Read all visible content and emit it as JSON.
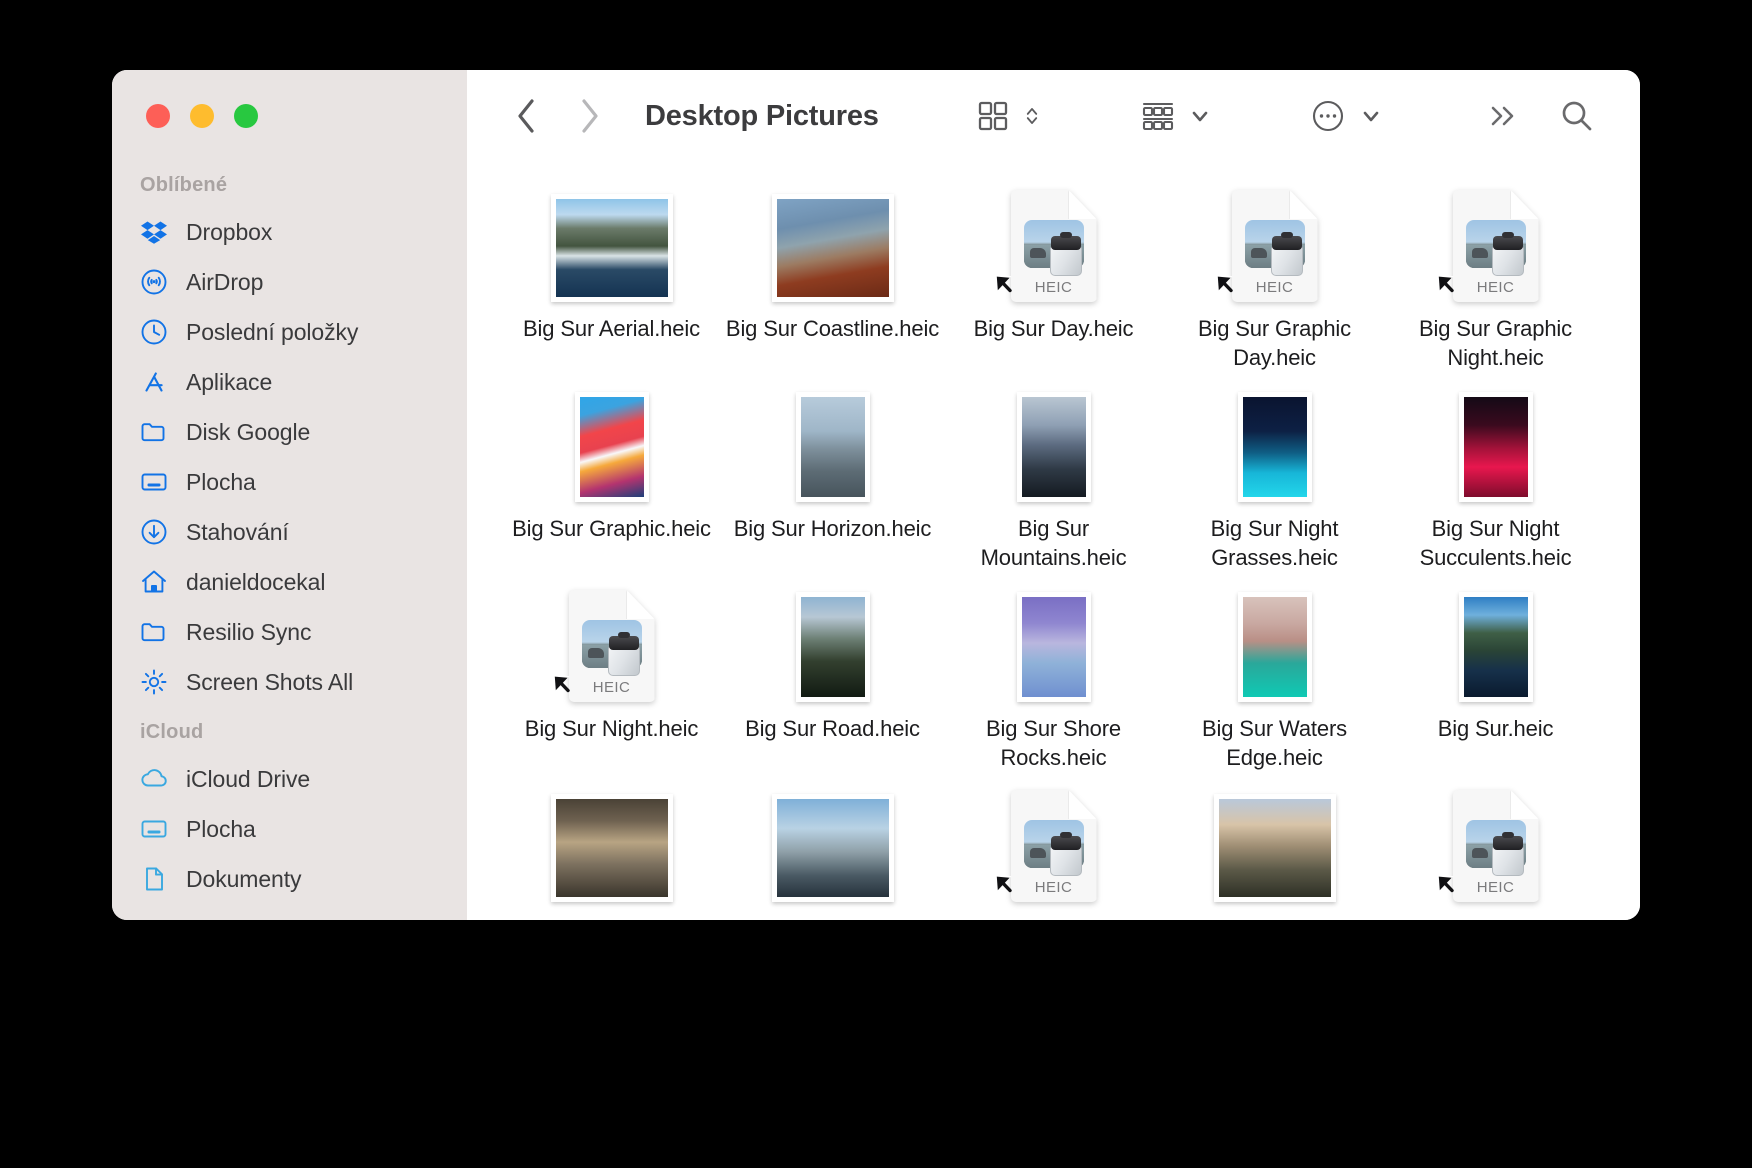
{
  "window": {
    "title": "Desktop Pictures",
    "traffic_lights": [
      {
        "name": "close",
        "color": "#fd5f57"
      },
      {
        "name": "minimize",
        "color": "#febc2e"
      },
      {
        "name": "maximize",
        "color": "#28c840"
      }
    ]
  },
  "toolbar": {
    "back_label": "Back",
    "forward_label": "Forward",
    "view_label": "Icon View",
    "group_label": "Group By",
    "action_label": "More Actions",
    "overflow_label": "More Toolbar Items",
    "search_label": "Search"
  },
  "sidebar": {
    "sections": [
      {
        "title": "Oblíbené",
        "items": [
          {
            "label": "Dropbox",
            "icon": "dropbox-icon",
            "color": "#1273e6"
          },
          {
            "label": "AirDrop",
            "icon": "airdrop-icon",
            "color": "#1273e6"
          },
          {
            "label": "Poslední položky",
            "icon": "clock-icon",
            "color": "#1273e6"
          },
          {
            "label": "Aplikace",
            "icon": "appstore-icon",
            "color": "#1273e6"
          },
          {
            "label": "Disk Google",
            "icon": "folder-icon",
            "color": "#1273e6"
          },
          {
            "label": "Plocha",
            "icon": "desktop-icon",
            "color": "#1273e6"
          },
          {
            "label": "Stahování",
            "icon": "download-icon",
            "color": "#1273e6"
          },
          {
            "label": "danieldocekal",
            "icon": "home-icon",
            "color": "#1273e6"
          },
          {
            "label": "Resilio Sync",
            "icon": "folder-icon",
            "color": "#1273e6"
          },
          {
            "label": "Screen Shots All",
            "icon": "gear-icon",
            "color": "#1273e6"
          }
        ]
      },
      {
        "title": "iCloud",
        "items": [
          {
            "label": "iCloud Drive",
            "icon": "cloud-icon",
            "color": "#3aa8e0"
          },
          {
            "label": "Plocha",
            "icon": "desktop-icon",
            "color": "#3aa8e0"
          },
          {
            "label": "Dokumenty",
            "icon": "document-icon",
            "color": "#3aa8e0"
          }
        ]
      }
    ]
  },
  "files": [
    {
      "name": "Big Sur Aerial.heic",
      "kind": "photo",
      "orientation": "landscape",
      "thumb": "linear-gradient(180deg,#8fc4e8 0%,#bdd9ef 16%,#6b7b6a 30%,#43543f 48%,#d9e3e6 58%,#2a4a66 72%,#143352 100%)",
      "alias": false
    },
    {
      "name": "Big Sur Coastline.heic",
      "kind": "photo",
      "orientation": "landscape",
      "thumb": "linear-gradient(170deg,#7fa3c4 0%,#6e8fae 26%,#8fa3ad 42%,#9c7b62 58%,#8e3c20 74%,#6b2a16 100%)",
      "alias": false
    },
    {
      "name": "Big Sur Day.heic",
      "kind": "heic-doc",
      "orientation": "doc",
      "thumb": "",
      "alias": true
    },
    {
      "name": "Big Sur Graphic Day.heic",
      "kind": "heic-doc",
      "orientation": "doc",
      "thumb": "",
      "alias": true
    },
    {
      "name": "Big Sur Graphic Night.heic",
      "kind": "heic-doc",
      "orientation": "doc",
      "thumb": "",
      "alias": true
    },
    {
      "name": "Big Sur Graphic.heic",
      "kind": "photo",
      "orientation": "portrait",
      "thumb": "linear-gradient(165deg,#2fa6e8 0%,#3ba3e0 16%,#f2454a 34%,#e8424f 48%,#f8f8fa 56%,#f6a93c 64%,#b4346f 82%,#1d3f7a 100%)",
      "alias": false
    },
    {
      "name": "Big Sur Horizon.heic",
      "kind": "photo",
      "orientation": "portrait",
      "thumb": "linear-gradient(180deg,#b7cbdb 0%,#9fb6c8 34%,#7e909c 52%,#5d6c75 74%,#47545c 100%)",
      "alias": false
    },
    {
      "name": "Big Sur Mountains.heic",
      "kind": "photo",
      "orientation": "portrait",
      "thumb": "linear-gradient(180deg,#b9c6d2 0%,#8fa0b4 28%,#5c6b80 48%,#2f3a46 72%,#141a21 100%)",
      "alias": false
    },
    {
      "name": "Big Sur Night Grasses.heic",
      "kind": "photo",
      "orientation": "portrait",
      "thumb": "linear-gradient(180deg,#0a1430 0%,#0d2044 34%,#0f5f86 56%,#17b6d8 76%,#23d6ea 100%)",
      "alias": false
    },
    {
      "name": "Big Sur Night Succulents.heic",
      "kind": "photo",
      "orientation": "portrait",
      "thumb": "linear-gradient(180deg,#140a16 0%,#3a0a1e 28%,#a6123a 52%,#e8174e 70%,#7e0c2c 100%)",
      "alias": false
    },
    {
      "name": "Big Sur Night.heic",
      "kind": "heic-doc",
      "orientation": "doc",
      "thumb": "",
      "alias": true
    },
    {
      "name": "Big Sur Road.heic",
      "kind": "photo",
      "orientation": "portrait",
      "thumb": "linear-gradient(180deg,#8fb4d2 0%,#b7c7d4 20%,#6c7f74 42%,#33402f 64%,#111a12 100%)",
      "alias": false
    },
    {
      "name": "Big Sur Shore Rocks.heic",
      "kind": "photo",
      "orientation": "portrait",
      "thumb": "linear-gradient(180deg,#7a6fc4 0%,#8f86d0 26%,#b9b6de 46%,#8fb2d8 66%,#6f8fd0 100%)",
      "alias": false
    },
    {
      "name": "Big Sur Waters Edge.heic",
      "kind": "photo",
      "orientation": "portrait",
      "thumb": "linear-gradient(180deg,#d8c3bc 0%,#c9a9a2 26%,#b98f86 44%,#2aa79a 66%,#0fc9b4 100%)",
      "alias": false
    },
    {
      "name": "Big Sur.heic",
      "kind": "photo",
      "orientation": "portrait",
      "thumb": "linear-gradient(180deg,#2f7fc4 0%,#6fb0dc 18%,#3f5f46 36%,#2a4436 54%,#16304a 74%,#0a1a2e 100%)",
      "alias": false
    },
    {
      "name": "",
      "kind": "photo",
      "orientation": "landscape",
      "thumb": "linear-gradient(180deg,#4a4236 0%,#6e6150 22%,#b8a483 44%,#7e7260 66%,#3a352c 100%)",
      "alias": false
    },
    {
      "name": "",
      "kind": "photo",
      "orientation": "landscape",
      "thumb": "linear-gradient(180deg,#7fb0d8 0%,#b9d2e4 30%,#8fa0a8 54%,#4a5a64 78%,#26323c 100%)",
      "alias": false
    },
    {
      "name": "",
      "kind": "heic-doc",
      "orientation": "doc",
      "thumb": "",
      "alias": true
    },
    {
      "name": "",
      "kind": "photo",
      "orientation": "landscape",
      "thumb": "linear-gradient(180deg,#b9c8da 0%,#d8c4a8 26%,#9f8e74 48%,#5c5a48 72%,#2e3026 100%)",
      "alias": false
    },
    {
      "name": "",
      "kind": "heic-doc",
      "orientation": "doc",
      "thumb": "",
      "alias": true
    }
  ]
}
